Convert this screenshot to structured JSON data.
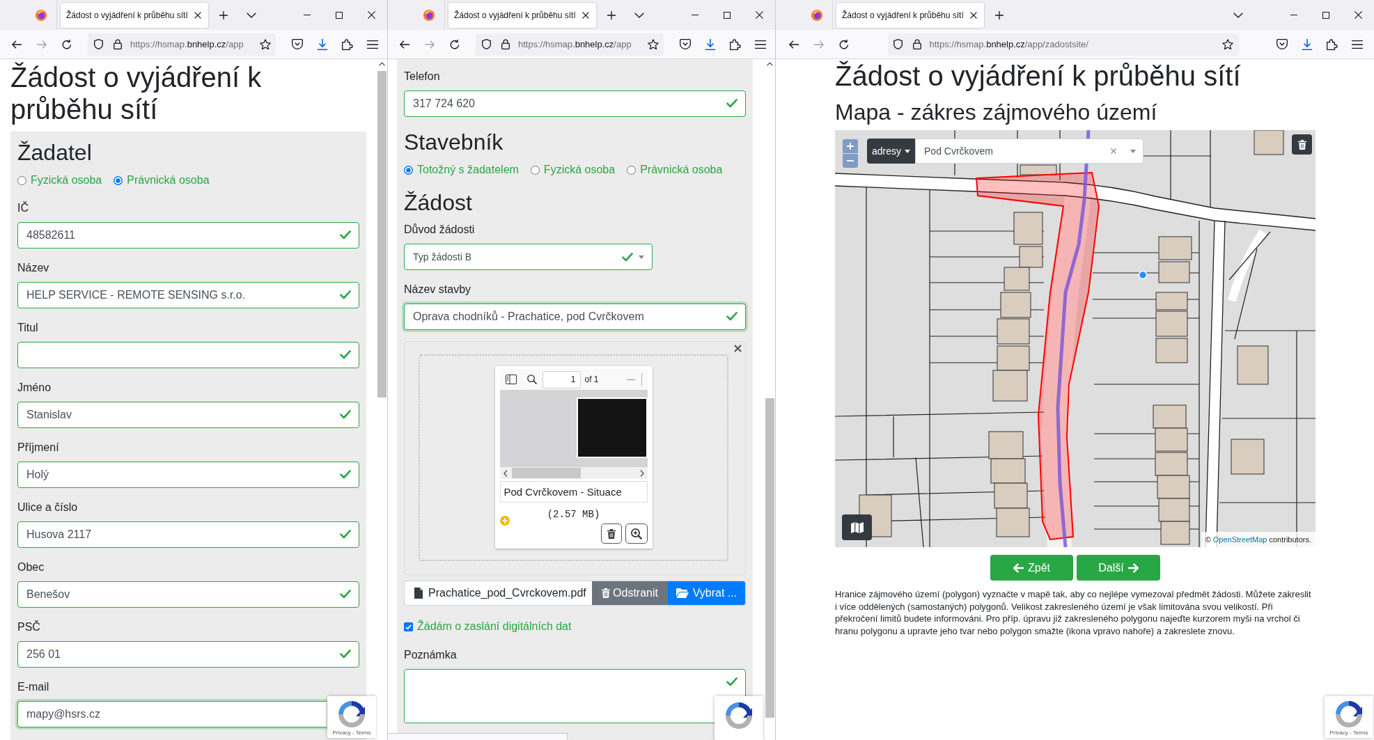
{
  "windows": [
    {
      "kind": "form_top",
      "tab_title": "Žádost o vyjádření k průběhu sítí",
      "url": {
        "prefix": "https://hsmap.",
        "domain": "bnhelp.cz",
        "path": "/app"
      },
      "title": "Žádost o vyjádření k průběhu sítí",
      "blocks": [
        {
          "kind": "heading",
          "text": "Žadatel"
        },
        {
          "kind": "radios",
          "options": [
            {
              "label": "Fyzická osoba",
              "selected": false
            },
            {
              "label": "Právnická osoba",
              "selected": true
            }
          ]
        },
        {
          "kind": "field",
          "label": "IČ",
          "value": "48582611",
          "valid": true,
          "tick": true,
          "focused": false
        },
        {
          "kind": "field",
          "label": "Název",
          "value": "HELP SERVICE - REMOTE SENSING s.r.o.",
          "valid": true,
          "tick": true,
          "focused": false
        },
        {
          "kind": "field",
          "label": "Titul",
          "valid": true,
          "tick": true,
          "focused": false
        },
        {
          "kind": "field",
          "label": "Jméno",
          "value": "Stanislav",
          "valid": true,
          "tick": true,
          "focused": false
        },
        {
          "kind": "field",
          "label": "Příjmení",
          "value": "Holý",
          "valid": true,
          "tick": true,
          "focused": false
        },
        {
          "kind": "field",
          "label": "Ulice a číslo",
          "value": "Husova 2117",
          "valid": true,
          "tick": true,
          "focused": false
        },
        {
          "kind": "field",
          "label": "Obec",
          "value": "Benešov",
          "valid": true,
          "tick": true,
          "focused": false
        },
        {
          "kind": "field",
          "label": "PSČ",
          "value": "256 01",
          "valid": true,
          "tick": true,
          "focused": false
        },
        {
          "kind": "field",
          "label": "E-mail",
          "value": "mapy@hsrs.cz",
          "valid": true,
          "tick": false,
          "focused": true
        }
      ],
      "recaptcha": {
        "kind": "full",
        "links": "Privacy - Terms"
      }
    },
    {
      "kind": "form_scrolled",
      "tab_title": "Žádost o vyjádření k průběhu sítí",
      "url": {
        "prefix": "https://hsmap.",
        "domain": "bnhelp.cz",
        "path": "/app"
      },
      "blocks": [
        {
          "kind": "field",
          "label": "Telefon",
          "value": "317 724 620",
          "valid": true,
          "tick": true,
          "focused": false
        },
        {
          "kind": "heading",
          "text": "Stavebník"
        },
        {
          "kind": "radios",
          "options": [
            {
              "label": "Totožný s žadatelem",
              "selected": true
            },
            {
              "label": "Fyzická osoba",
              "selected": false
            },
            {
              "label": "Právnická osoba",
              "selected": false
            }
          ]
        },
        {
          "kind": "heading",
          "text": "Žádost"
        },
        {
          "kind": "select",
          "label": "Důvod žádosti",
          "value": "Typ žádosti B",
          "valid": true,
          "tick": true
        },
        {
          "kind": "field",
          "label": "Název stavby",
          "value": "Oprava chodníků - Prachatice, pod Cvrčkovem",
          "valid": true,
          "tick": true,
          "focused": true
        },
        {
          "kind": "attachment",
          "page": "1",
          "page_count": "of 1",
          "caption": "Pod Cvrčkovem - Situace",
          "size": "(2.57 MB)"
        },
        {
          "kind": "file_input",
          "file_name": "Prachatice_pod_Cvrckovem.pdf",
          "buttons": [
            {
              "kind": "remove",
              "label": "Odstranit"
            },
            {
              "kind": "browse",
              "label": "Vybrat ..."
            }
          ]
        },
        {
          "kind": "checkbox",
          "label": "Žádám o zaslání digitálních dat",
          "checked": true
        },
        {
          "kind": "textarea",
          "label": "Poznámka",
          "valid": true,
          "tick": true
        }
      ],
      "recaptcha": {
        "kind": "cropped"
      },
      "link_status_bar": true
    },
    {
      "kind": "map_step",
      "tab_title": "Žádost o vyjádření k průběhu sítí",
      "url": {
        "prefix": "https://hsmap.",
        "domain": "bnhelp.cz",
        "path": "/app/zadostsite/"
      },
      "title": "Žádost o vyjádření k průběhu sítí",
      "subtitle": "Mapa - zákres zájmového území",
      "map": {
        "search": {
          "scope": "adresy",
          "value": "Pod Cvrčkovem"
        },
        "attribution": {
          "prefix": "©",
          "link": "OpenStreetMap",
          "suffix": "contributors."
        }
      },
      "buttons": [
        {
          "kind": "back",
          "label": "Zpět"
        },
        {
          "kind": "next",
          "label": "Další"
        }
      ],
      "help": "Hranice zájmového území (polygon) vyznačte v mapě tak, aby co nejlépe vymezoval předmět žádosti. Můžete zakreslit i více oddělených (samostaných) polygonů. Velikost zakresleného území je však limitována svou velikostí. Při překročení limitů budete informováni. Pro příp. úpravu již zakresleného polygonu najeďte kurzorem myši na vrchol či hranu polygonu a upravte jeho tvar nebo polygon smažte (ikona vpravo nahoře) a zakreslete znovu.",
      "recaptcha": {
        "kind": "full",
        "links": "Privacy - Terms"
      }
    }
  ]
}
